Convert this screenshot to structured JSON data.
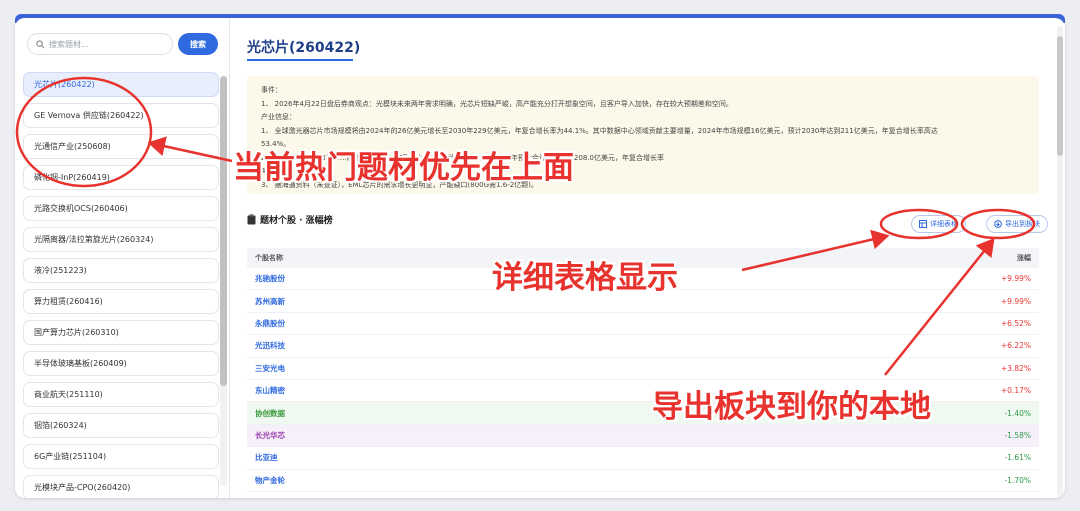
{
  "sidebar": {
    "search_placeholder": "搜索题材...",
    "search_button": "搜索",
    "items": [
      "光芯片(260422)",
      "GE Vernova 供应链(260422)",
      "光通信产业(250608)",
      "磷化铟-InP(260419)",
      "光路交换机OCS(260406)",
      "光隔离器/法拉第旋光片(260324)",
      "液冷(251223)",
      "算力租赁(260416)",
      "国产算力芯片(260310)",
      "半导体玻璃基板(260409)",
      "商业航天(251110)",
      "铟箔(260324)",
      "6G产业链(251104)",
      "光模块产品-CPO(260420)"
    ],
    "active_index": 0
  },
  "main": {
    "title": "光芯片(260422)",
    "info_lines": [
      "事件：",
      "1、 2026年4月22日盘后券商观点：光模块未来两年需求明确，光芯片短缺严峻，高产能充分打开想象空间，且客户导入加快，存在较大预期差和空间。",
      "产业信息：",
      "1、 全球激光器芯片市场规模将由2024年的26亿美元增长至2030年229亿美元，年复合增长率为44.1%。其中数据中心领域贡献主要增量，2024年市场规模16亿美元，预计2030年达到211亿美元，年复合增长率高达",
      "53.4%。",
      "2、 中国……                                                                                   ……市场……随着800G、1.6T及以上高速方案快速渗透，到2030年预计合计收入将达208.0亿美元，年复合增长率",
      "4…",
      "3、 据海通资料（未查证），EML芯片的需求增长更明显，产能缺口(800G需1.6-2亿颗)。"
    ],
    "section_title": "题材个股 · 涨幅榜",
    "detail_button": "详细表格",
    "export_button": "导出到板块",
    "table": {
      "col_name": "个股名称",
      "col_change": "涨幅",
      "rows": [
        {
          "name": "兆驰股份",
          "change": "+9.99%",
          "dir": "up",
          "bg": ""
        },
        {
          "name": "苏州高新",
          "change": "+9.99%",
          "dir": "up",
          "bg": ""
        },
        {
          "name": "永鼎股份",
          "change": "+6.52%",
          "dir": "up",
          "bg": ""
        },
        {
          "name": "光迅科技",
          "change": "+6.22%",
          "dir": "up",
          "bg": ""
        },
        {
          "name": "三安光电",
          "change": "+3.82%",
          "dir": "up",
          "bg": ""
        },
        {
          "name": "东山精密",
          "change": "+0.17%",
          "dir": "up",
          "bg": ""
        },
        {
          "name": "协创数据",
          "change": "-1.40%",
          "dir": "down",
          "bg": "green"
        },
        {
          "name": "长光华芯",
          "change": "-1.58%",
          "dir": "down",
          "bg": "purple"
        },
        {
          "name": "比亚迪",
          "change": "-1.61%",
          "dir": "down",
          "bg": ""
        },
        {
          "name": "物产金轮",
          "change": "-1.70%",
          "dir": "down",
          "bg": ""
        }
      ]
    }
  },
  "annotations": {
    "hot_topics": "当前热门题材优先在上面",
    "detail_table": "详细表格显示",
    "export_local": "导出板块到你的本地"
  },
  "colors": {
    "accent": "#2f6ae0",
    "annotation": "#e8322e",
    "up": "#e53935",
    "down": "#2e9d4a"
  }
}
